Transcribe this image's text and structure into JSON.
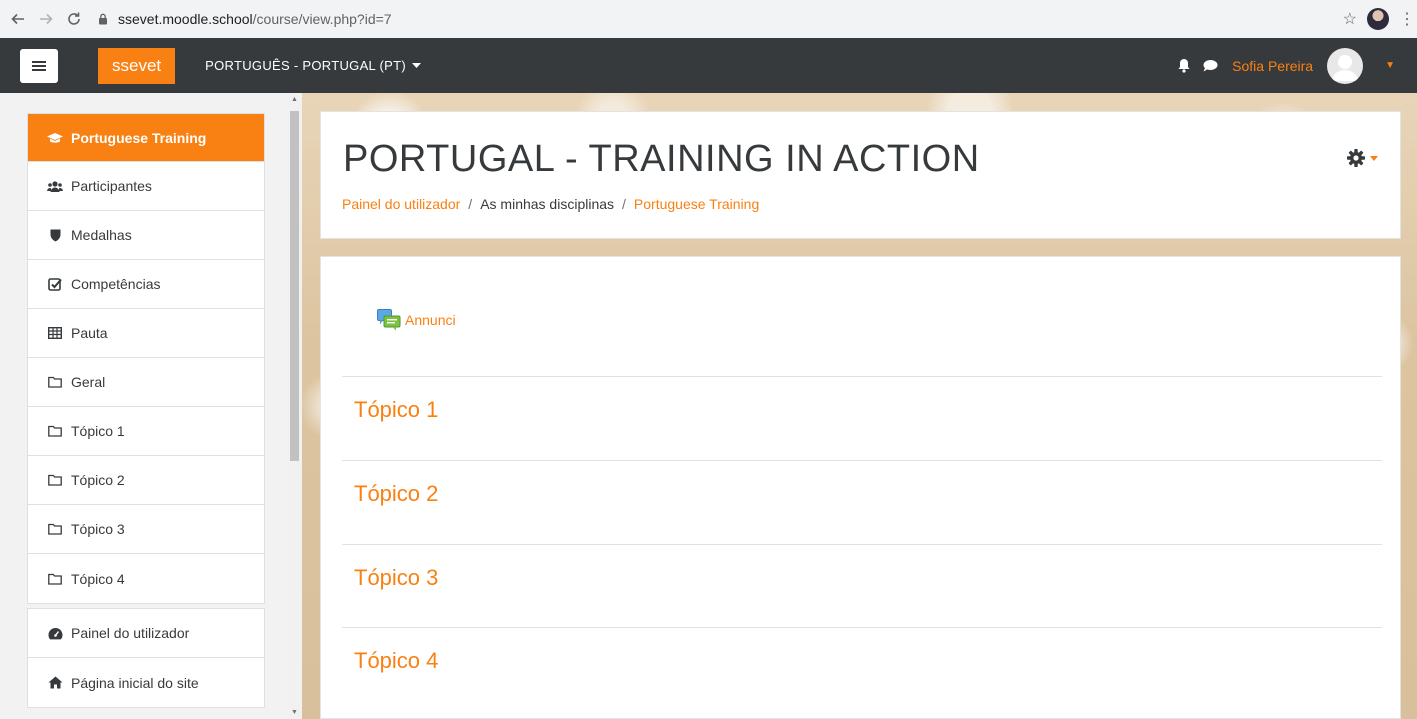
{
  "browser": {
    "url_host": "ssevet.moodle.school",
    "url_path": "/course/view.php?id=7",
    "back_icon": "arrow-left-icon",
    "forward_icon": "arrow-right-icon",
    "reload_icon": "reload-icon"
  },
  "navbar": {
    "brand": "ssevet",
    "language": "PORTUGUÊS - PORTUGAL (PT)",
    "user_name": "Sofia Pereira",
    "bg_color": "#373a3c",
    "accent": "#f98012"
  },
  "sidebar": {
    "items": [
      {
        "label": "Portuguese Training",
        "icon": "graduation-cap-icon",
        "active": true
      },
      {
        "label": "Participantes",
        "icon": "users-icon"
      },
      {
        "label": "Medalhas",
        "icon": "shield-icon"
      },
      {
        "label": "Competências",
        "icon": "check-square-icon"
      },
      {
        "label": "Pauta",
        "icon": "table-icon"
      },
      {
        "label": "Geral",
        "icon": "folder-icon"
      },
      {
        "label": "Tópico 1",
        "icon": "folder-icon"
      },
      {
        "label": "Tópico 2",
        "icon": "folder-icon"
      },
      {
        "label": "Tópico 3",
        "icon": "folder-icon"
      },
      {
        "label": "Tópico 4",
        "icon": "folder-icon"
      }
    ],
    "items2": [
      {
        "label": "Painel do utilizador",
        "icon": "dashboard-icon"
      },
      {
        "label": "Página inicial do site",
        "icon": "home-icon"
      }
    ]
  },
  "header": {
    "title": "PORTUGAL - TRAINING IN ACTION",
    "breadcrumb": {
      "item1": "Painel do utilizador",
      "item2": "As minhas disciplinas",
      "item3": "Portuguese Training",
      "separator": "/"
    }
  },
  "main": {
    "activity_label": "Annunci",
    "sections": [
      "Tópico 1",
      "Tópico 2",
      "Tópico 3",
      "Tópico 4"
    ]
  }
}
